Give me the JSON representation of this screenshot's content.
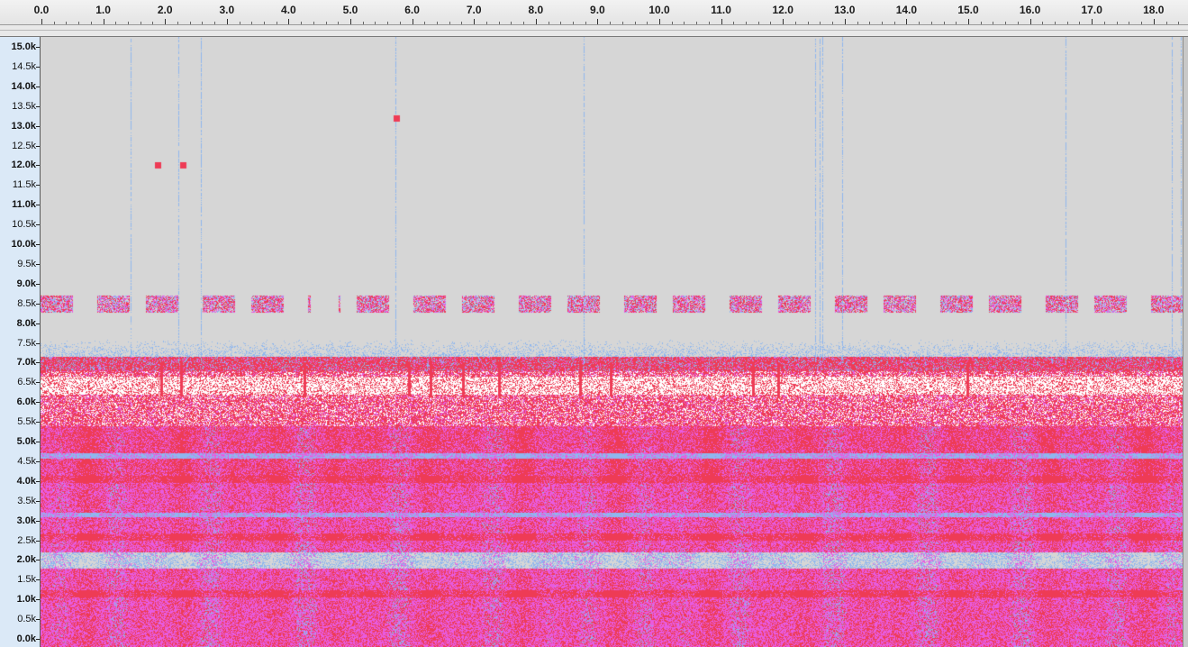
{
  "timeline": {
    "labels": [
      "0.0",
      "1.0",
      "2.0",
      "3.0",
      "4.0",
      "5.0",
      "6.0",
      "7.0",
      "8.0",
      "9.0",
      "10.0",
      "11.0",
      "12.0",
      "13.0",
      "14.0",
      "15.0",
      "16.0",
      "17.0",
      "18.0"
    ],
    "duration_seconds": 18.5
  },
  "frequency_axis": {
    "labels": [
      "15.0k",
      "14.5k",
      "14.0k",
      "13.5k",
      "13.0k",
      "12.5k",
      "12.0k",
      "11.5k",
      "11.0k",
      "10.5k",
      "10.0k",
      "9.5k",
      "9.0k",
      "8.5k",
      "8.0k",
      "7.5k",
      "7.0k",
      "6.5k",
      "6.0k",
      "5.5k",
      "5.0k",
      "4.5k",
      "4.0k",
      "3.5k",
      "3.0k",
      "2.5k",
      "2.0k",
      "1.5k",
      "1.0k",
      "0.5k",
      "0.0k"
    ],
    "max_hz": 15000
  },
  "spectrogram": {
    "colors": {
      "background": "#d6d6d6",
      "low": "#8fb7ee",
      "mid": "#e85be0",
      "high": "#ee3b55",
      "peak": "#ffffff"
    }
  }
}
